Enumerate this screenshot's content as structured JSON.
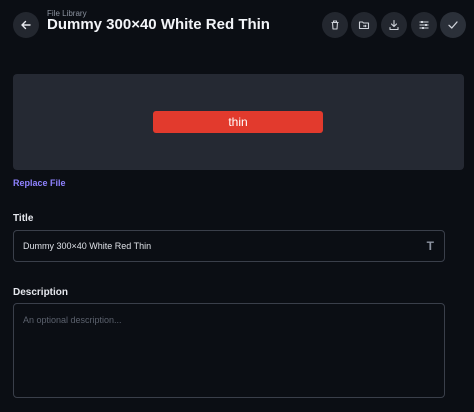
{
  "header": {
    "breadcrumb": "File Library",
    "title": "Dummy 300×40 White Red Thin",
    "icons": [
      "back-arrow-icon",
      "trash-icon",
      "folder-move-icon",
      "download-icon",
      "sliders-icon",
      "check-icon"
    ]
  },
  "preview": {
    "image_text": "thin",
    "image_color": "#e23a2d"
  },
  "replace_label": "Replace File",
  "fields": {
    "title_label": "Title",
    "title_value": "Dummy 300×40 White Red Thin",
    "description_label": "Description",
    "description_placeholder": "An optional description..."
  },
  "colors": {
    "accent": "#8f82ff",
    "background": "#0b0e14"
  }
}
